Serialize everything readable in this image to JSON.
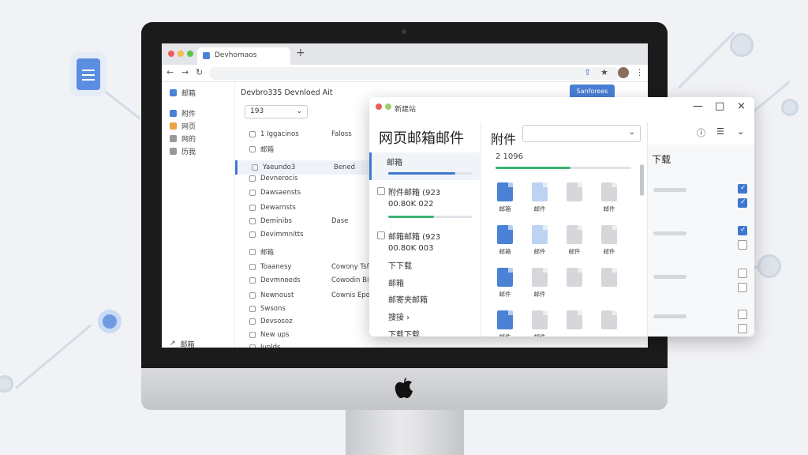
{
  "browser": {
    "tab_title": "Devhomaos",
    "tab_add": "+",
    "nav_back": "←",
    "nav_forward": "→",
    "nav_reload": "↻"
  },
  "background_app": {
    "title": "Devbro335 Devnloed Ait",
    "version": "193",
    "header_btn": "Sanforees",
    "sidebar": [
      {
        "label": "邮箱",
        "color": "#4a82d6"
      },
      {
        "label": "附件",
        "color": "#4a82d6"
      },
      {
        "label": "网页",
        "color": "#e8a24a"
      },
      {
        "label": "网的",
        "color": "#999999"
      },
      {
        "label": "历我",
        "color": "#999999"
      }
    ],
    "sidebar_footer": "邮箱",
    "list": [
      {
        "name": "1 Iggacinos",
        "meta": "Faloss"
      },
      {
        "name": "邮箱",
        "meta": ""
      },
      {
        "name": "Yaeundo3",
        "meta": "Bened",
        "selected": true
      },
      {
        "name": "Devnerocis",
        "meta": ""
      },
      {
        "name": "Dawsaensts",
        "meta": ""
      },
      {
        "name": "Dewarnsts",
        "meta": ""
      },
      {
        "name": "Deminibs",
        "meta": "Dase"
      },
      {
        "name": "Devimmnitts",
        "meta": ""
      },
      {
        "name": "邮箱",
        "meta": ""
      },
      {
        "name": "Toaanesy",
        "meta": "Cowony Tsfs"
      },
      {
        "name": "Devmnoeds",
        "meta": "Cowodin Bits"
      },
      {
        "name": "Newnoust",
        "meta": "Cownis Epot"
      },
      {
        "name": "Swsons",
        "meta": ""
      },
      {
        "name": "Devsosoz",
        "meta": ""
      },
      {
        "name": "New ups",
        "meta": ""
      },
      {
        "name": "Junlds",
        "meta": ""
      }
    ]
  },
  "popup": {
    "title": "新建站",
    "heading": "网页邮箱邮件",
    "left_items": [
      {
        "label": "邮箱"
      },
      {
        "label": "附件邮箱 (923",
        "sub": "00.80K 022"
      },
      {
        "label": "邮箱邮箱 (923",
        "sub": "00.80K 003"
      },
      {
        "label": "下下载"
      },
      {
        "label": "邮箱"
      },
      {
        "label": "邮寄夹邮箱"
      },
      {
        "label": "搜接 ›"
      },
      {
        "label": "下载下载"
      }
    ],
    "progress": {
      "top_fill": 0.8,
      "mid_fill": 0.55,
      "att_fill": 0.55
    },
    "attachments_label": "附件",
    "attachments_count": "2 1096",
    "files": [
      {
        "name": "邮箱",
        "color": "blue"
      },
      {
        "name": "邮件",
        "color": "lblue"
      },
      {
        "name": "",
        "color": "gray"
      },
      {
        "name": "邮件",
        "color": "gray"
      },
      {
        "name": "邮箱",
        "color": "blue"
      },
      {
        "name": "邮件",
        "color": "lblue"
      },
      {
        "name": "邮件",
        "color": "gray"
      },
      {
        "name": "邮件",
        "color": "gray"
      },
      {
        "name": "邮件",
        "color": "blue"
      },
      {
        "name": "邮件",
        "color": "gray"
      },
      {
        "name": "",
        "color": "gray"
      },
      {
        "name": "",
        "color": "gray"
      },
      {
        "name": "邮件",
        "color": "blue"
      },
      {
        "name": "邮件",
        "color": "gray"
      },
      {
        "name": "",
        "color": "gray"
      },
      {
        "name": "",
        "color": "gray"
      }
    ],
    "download_label": "下载",
    "checkboxes": [
      true,
      true,
      true,
      false,
      false,
      false,
      false,
      false
    ],
    "win_close": "×",
    "win_max": "□",
    "win_min": "—"
  },
  "colors": {
    "accent": "#3f78d0",
    "progress_blue": "#3f78d0",
    "progress_green": "#3cb371"
  }
}
